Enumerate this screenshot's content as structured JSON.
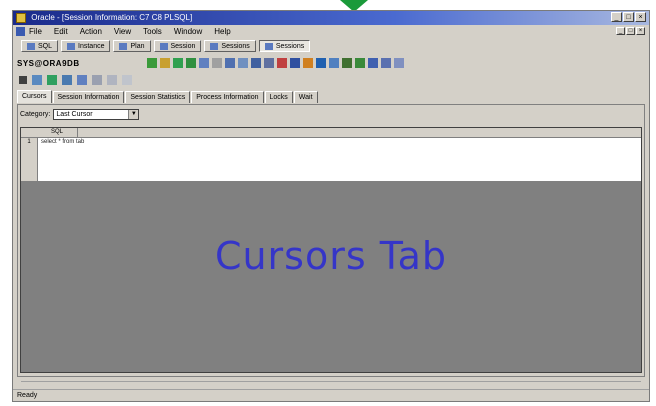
{
  "window": {
    "title": "Oracle - [Session Information: C7 C8 PLSQL]",
    "controls": [
      "_",
      "□",
      "×"
    ]
  },
  "menubar": {
    "items": [
      "File",
      "Edit",
      "Action",
      "View",
      "Tools",
      "Window",
      "Help"
    ]
  },
  "taskbar": {
    "buttons": [
      {
        "label": "SQL",
        "active": false
      },
      {
        "label": "Instance",
        "active": false
      },
      {
        "label": "Plan",
        "active": false
      },
      {
        "label": "Session",
        "active": false
      },
      {
        "label": "Sessions",
        "active": false
      },
      {
        "label": "Sessions",
        "active": true
      }
    ]
  },
  "toolbar": {
    "instance_label": "SYS@ORA9DB"
  },
  "tabs": {
    "items": [
      {
        "label": "Cursors",
        "active": true
      },
      {
        "label": "Session Information",
        "active": false
      },
      {
        "label": "Session Statistics",
        "active": false
      },
      {
        "label": "Process Information",
        "active": false
      },
      {
        "label": "Locks",
        "active": false
      },
      {
        "label": "Wait",
        "active": false
      }
    ]
  },
  "category": {
    "label": "Category:",
    "value": "Last Cursor"
  },
  "grid": {
    "header": "SQL",
    "rows": [
      {
        "num": "1",
        "text": "select * from tab"
      }
    ]
  },
  "overlay": {
    "text": "Cursors Tab"
  },
  "status": {
    "text": "Ready"
  }
}
